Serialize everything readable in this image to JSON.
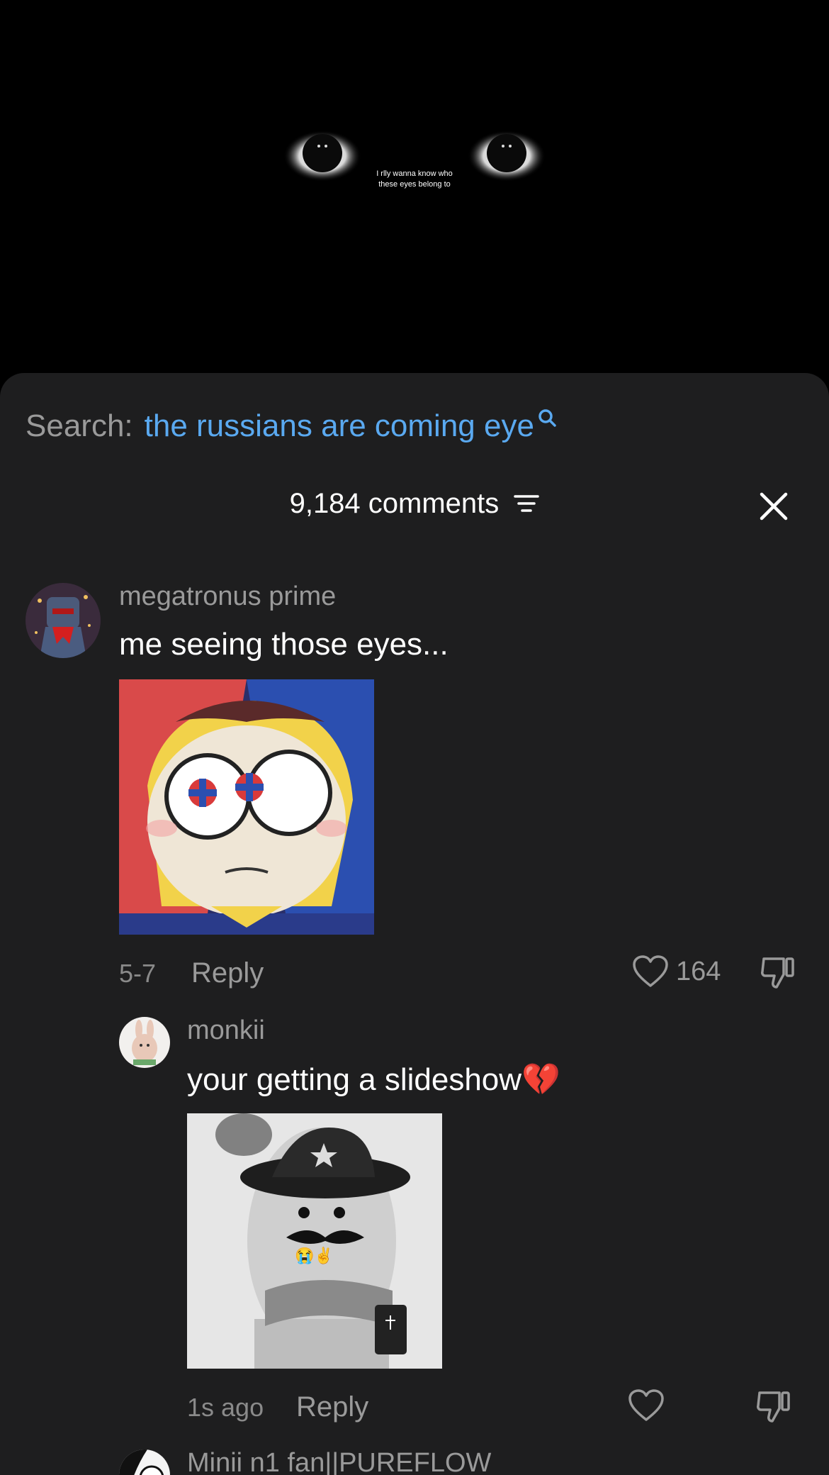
{
  "video": {
    "caption_line1": "I rlly wanna know who",
    "caption_line2": "these eyes belong to"
  },
  "search": {
    "label": "Search:",
    "query": "the russians are coming eye"
  },
  "comments_header": {
    "count_label": "9,184 comments"
  },
  "comments": [
    {
      "username": "megatronus prime",
      "text": "me seeing those eyes...",
      "time": "5-7",
      "reply_label": "Reply",
      "likes": "164"
    }
  ],
  "replies": [
    {
      "username": "monkii",
      "text": "your getting a slideshow",
      "emoji": "💔",
      "media_emoji": "😭✌",
      "time": "1s ago",
      "reply_label": "Reply"
    }
  ],
  "next_comment": {
    "username": "Minii n1 fan||PUREFLOW"
  },
  "colors": {
    "sheet_bg": "#1e1e1f",
    "accent_link": "#5aa9f0",
    "muted_text": "#9a9a9a"
  }
}
